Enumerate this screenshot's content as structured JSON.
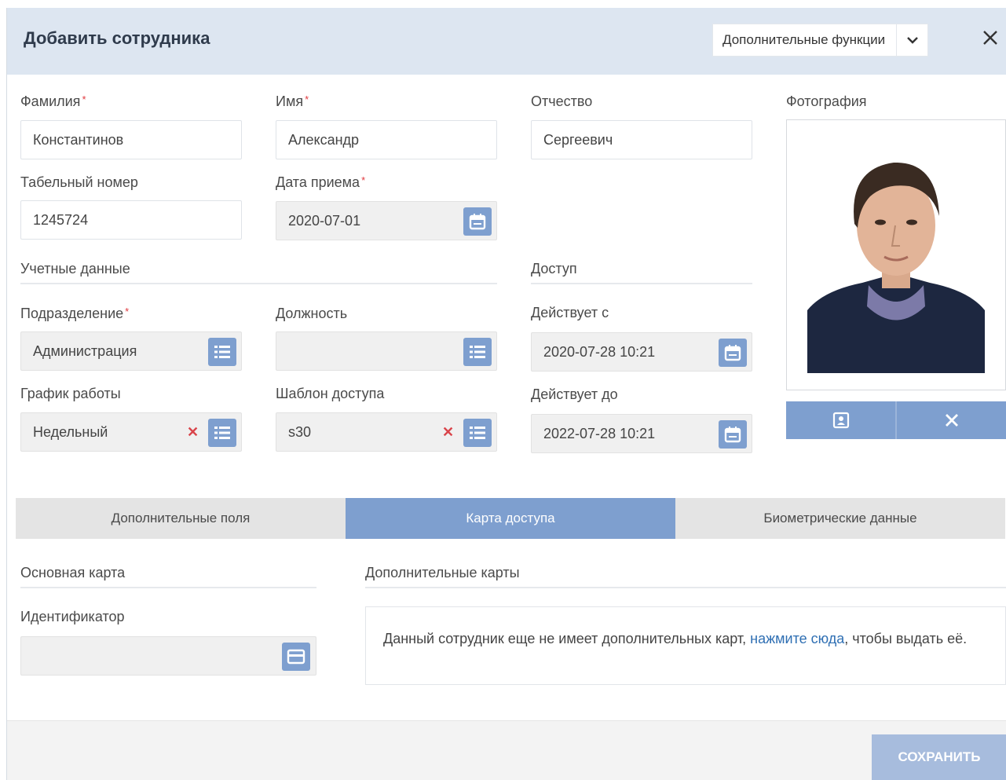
{
  "header": {
    "title": "Добавить сотрудника",
    "more_label": "Дополнительные функции"
  },
  "fields": {
    "last_name": {
      "label": "Фамилия",
      "value": "Константинов",
      "required": "*"
    },
    "first_name": {
      "label": "Имя",
      "value": "Александр",
      "required": "*"
    },
    "middle_name": {
      "label": "Отчество",
      "value": "Сергеевич"
    },
    "personnel_number": {
      "label": "Табельный номер",
      "value": "1245724"
    },
    "hire_date": {
      "label": "Дата приема",
      "value": "2020-07-01",
      "required": "*"
    },
    "department": {
      "label": "Подразделение",
      "value": "Администрация",
      "required": "*"
    },
    "position": {
      "label": "Должность",
      "value": ""
    },
    "work_schedule": {
      "label": "График работы",
      "value": "Недельный"
    },
    "access_template": {
      "label": "Шаблон доступа",
      "value": "s30"
    },
    "valid_from": {
      "label": "Действует с",
      "value": "2020-07-28 10:21"
    },
    "valid_to": {
      "label": "Действует до",
      "value": "2022-07-28 10:21"
    }
  },
  "sections": {
    "account": "Учетные данные",
    "access": "Доступ",
    "photo": "Фотография"
  },
  "tabs": [
    {
      "label": "Дополнительные поля",
      "active": false
    },
    {
      "label": "Карта доступа",
      "active": true
    },
    {
      "label": "Биометрические данные",
      "active": false
    }
  ],
  "card": {
    "main_title": "Основная карта",
    "identifier_label": "Идентификатор",
    "identifier_value": "",
    "extra_title": "Дополнительные карты",
    "info_before": "Данный сотрудник еще не имеет дополнительных карт, ",
    "info_link": "нажмите сюда",
    "info_after": ", чтобы выдать её."
  },
  "footer": {
    "save_label": "СОХРАНИТЬ"
  },
  "colors": {
    "accent": "#7e9fcf",
    "header_bg": "#dde6f1",
    "required": "#e0393e",
    "link": "#2f6fb3",
    "save_disabled": "#a7bcdd"
  },
  "icons": {
    "calendar": "calendar-icon",
    "list": "list-icon",
    "card": "card-icon",
    "photo_upload": "portrait-icon",
    "close": "close-icon",
    "chevron": "chevron-down-icon"
  }
}
